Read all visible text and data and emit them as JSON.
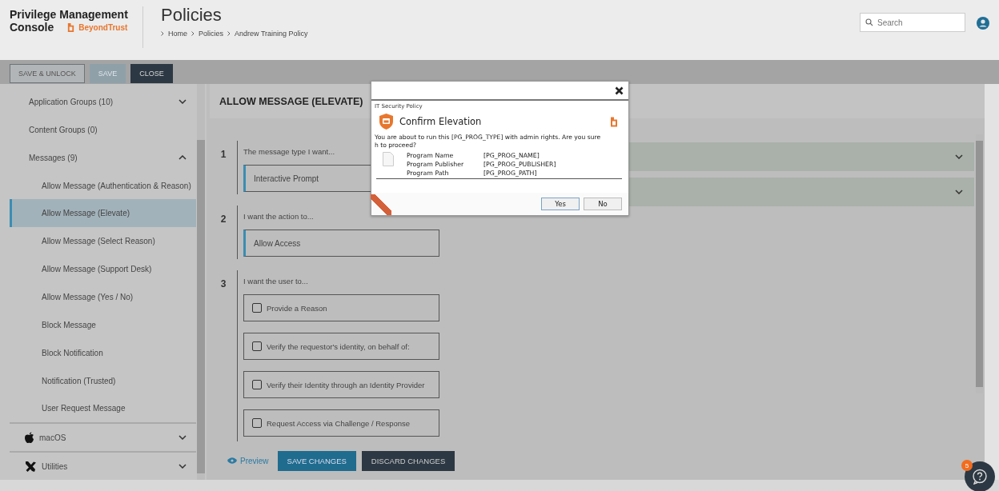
{
  "header": {
    "app_name": [
      "Privilege Management",
      "Console"
    ],
    "brand": "BeyondTrust",
    "page_title": "Policies",
    "breadcrumb": [
      "Home",
      "Policies",
      "Andrew Training Policy"
    ],
    "search": {
      "placeholder": "Search"
    }
  },
  "toolbar": [
    {
      "label": "SAVE & UNLOCK",
      "kind": "outline",
      "disabled": false
    },
    {
      "label": "SAVE",
      "kind": "primary",
      "disabled": true
    },
    {
      "label": "CLOSE",
      "kind": "dark",
      "disabled": false
    }
  ],
  "sidebar": {
    "groups": [
      {
        "label": "Application Groups (10)",
        "kind": "expandable",
        "expanded": false
      },
      {
        "label": "Content Groups (0)",
        "kind": "plain"
      },
      {
        "label": "Messages (9)",
        "kind": "expandable",
        "expanded": true,
        "children": [
          {
            "label": "Allow Message (Authentication & Reason)",
            "selected": false
          },
          {
            "label": "Allow Message (Elevate)",
            "selected": true
          },
          {
            "label": "Allow Message (Select Reason)",
            "selected": false
          },
          {
            "label": "Allow Message (Support Desk)",
            "selected": false
          },
          {
            "label": "Allow Message (Yes / No)",
            "selected": false
          },
          {
            "label": "Block Message",
            "selected": false
          },
          {
            "label": "Block Notification",
            "selected": false
          },
          {
            "label": "Notification (Trusted)",
            "selected": false
          },
          {
            "label": "User Request Message",
            "selected": false
          }
        ]
      }
    ],
    "platforms": [
      {
        "label": "macOS",
        "expanded": false
      },
      {
        "label": "Utilities",
        "expanded": false
      }
    ]
  },
  "panel": {
    "title": "ALLOW MESSAGE (ELEVATE)",
    "steps": [
      {
        "number": "1",
        "label": "The message type I want...",
        "kind": "select",
        "value": "Interactive Prompt"
      },
      {
        "number": "2",
        "label": "I want the action to...",
        "kind": "select",
        "value": "Allow Access"
      },
      {
        "number": "3",
        "label": "I want the user to...",
        "kind": "checks",
        "options": [
          {
            "label": "Provide a Reason",
            "checked": false
          },
          {
            "label": "Verify the requestor's identity, on behalf of:",
            "checked": false
          },
          {
            "label": "Verify their Identity through an Identity Provider",
            "checked": false
          },
          {
            "label": "Request Access via Challenge / Response",
            "checked": false
          }
        ]
      }
    ],
    "sections": [
      {
        "expanded": false
      },
      {
        "expanded": false
      }
    ],
    "footer": {
      "preview": "Preview",
      "buttons": [
        {
          "label": "SAVE CHANGES",
          "kind": "primary"
        },
        {
          "label": "DISCARD CHANGES",
          "kind": "dark"
        }
      ]
    }
  },
  "dialog": {
    "header": "IT Security Policy",
    "title": "Confirm Elevation",
    "message": [
      "You are about to run this [PG_PROG_TYPE] with admin rights. Are you sure",
      "h to proceed?"
    ],
    "fields": [
      {
        "label": "Program Name",
        "value": "[PG_PROG_NAME]"
      },
      {
        "label": "Program Publisher",
        "value": "[PG_PROG_PUBLISHER]"
      },
      {
        "label": "Program Path",
        "value": "[PG_PROG_PATH]"
      }
    ],
    "buttons": [
      {
        "label": "Yes",
        "selected": true
      },
      {
        "label": "No",
        "selected": false
      }
    ]
  },
  "help": {
    "badge": "5"
  }
}
